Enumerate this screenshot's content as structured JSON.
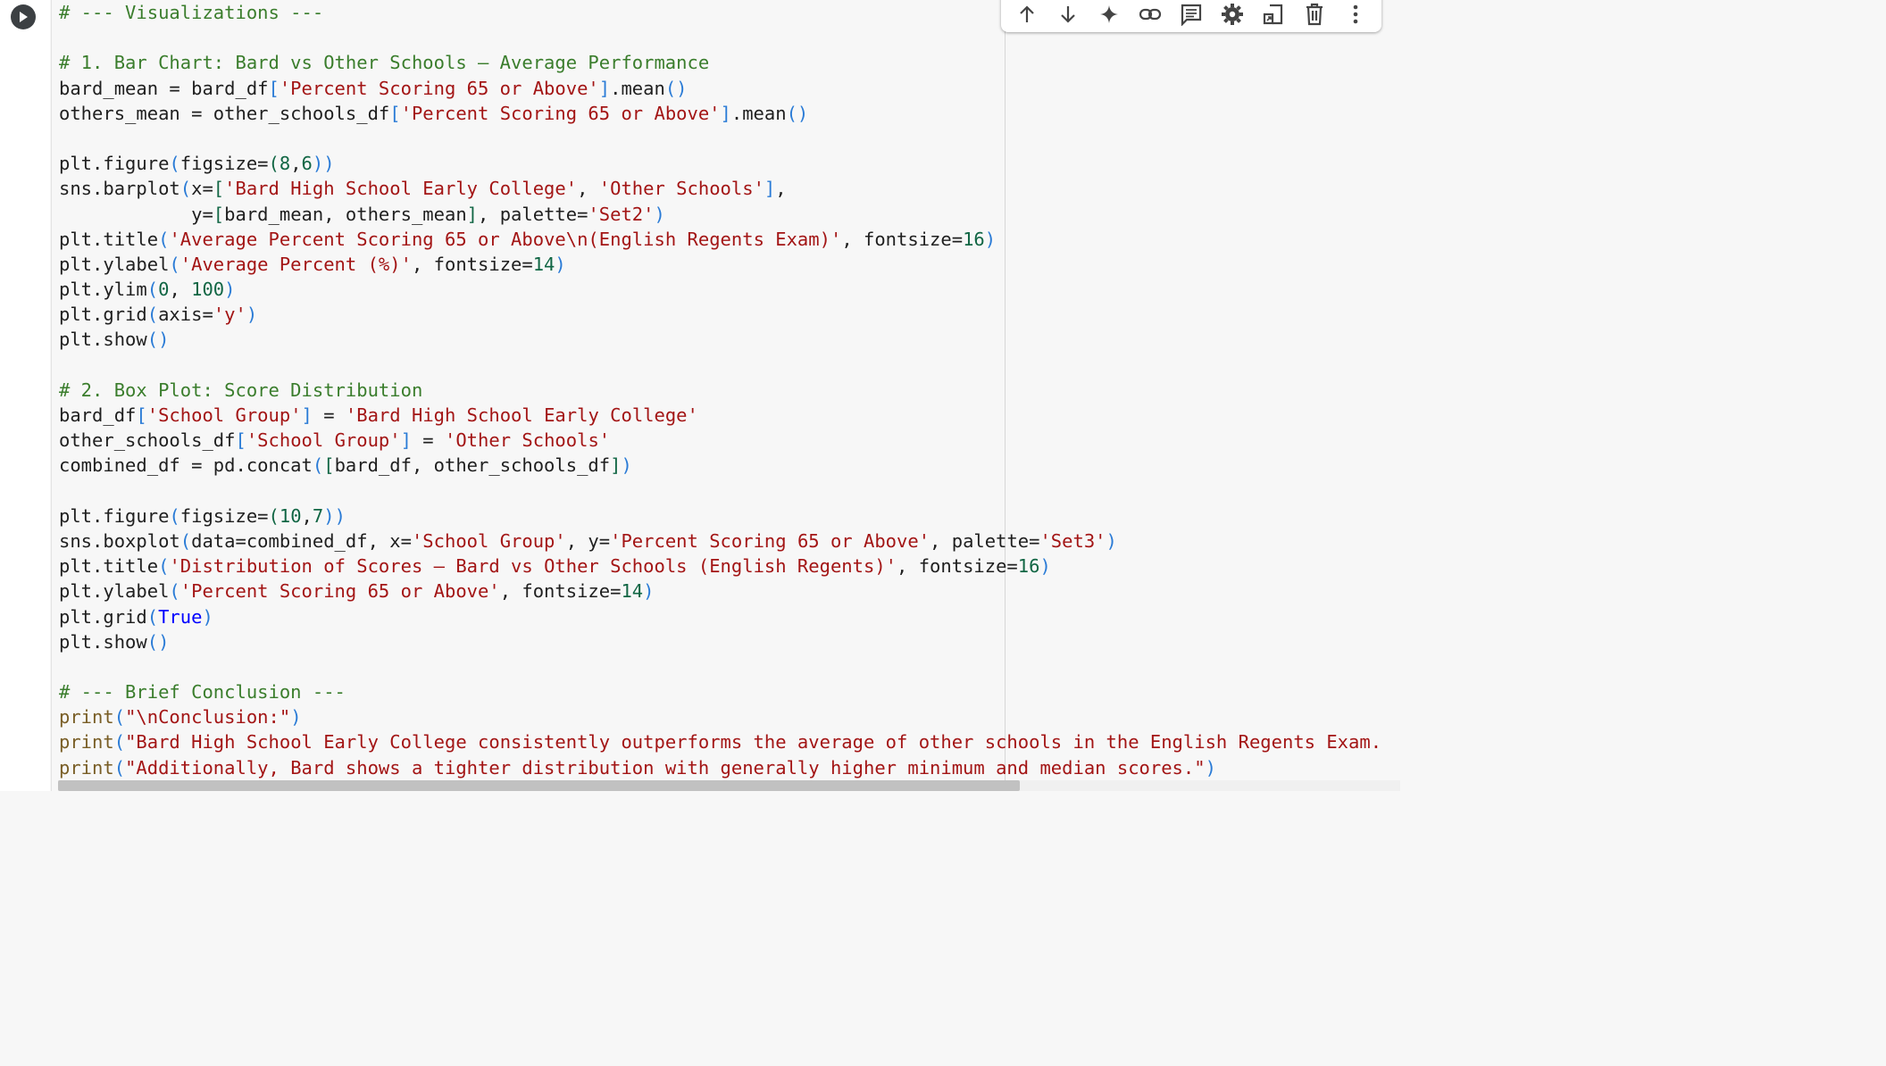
{
  "cell": {
    "run_icon": "play-icon",
    "lines": [
      [
        {
          "t": "# --- Visualizations ---",
          "c": "cm"
        }
      ],
      [],
      [
        {
          "t": "# 1. Bar Chart: Bard vs Other Schools – Average Performance",
          "c": "cm"
        }
      ],
      [
        {
          "t": "bard_mean = bard_df"
        },
        {
          "t": "[",
          "c": "br"
        },
        {
          "t": "'Percent Scoring 65 or Above'",
          "c": "st"
        },
        {
          "t": "]",
          "c": "br"
        },
        {
          "t": ".mean"
        },
        {
          "t": "()",
          "c": "br"
        }
      ],
      [
        {
          "t": "others_mean = other_schools_df"
        },
        {
          "t": "[",
          "c": "br"
        },
        {
          "t": "'Percent Scoring 65 or Above'",
          "c": "st"
        },
        {
          "t": "]",
          "c": "br"
        },
        {
          "t": ".mean"
        },
        {
          "t": "()",
          "c": "br"
        }
      ],
      [],
      [
        {
          "t": "plt.figure"
        },
        {
          "t": "(",
          "c": "br"
        },
        {
          "t": "figsize="
        },
        {
          "t": "(",
          "c": "nm"
        },
        {
          "t": "8",
          "c": "nm"
        },
        {
          "t": ","
        },
        {
          "t": "6",
          "c": "nm"
        },
        {
          "t": "))",
          "c": "br"
        }
      ],
      [
        {
          "t": "sns.barplot"
        },
        {
          "t": "(",
          "c": "br"
        },
        {
          "t": "x="
        },
        {
          "t": "[",
          "c": "nm"
        },
        {
          "t": "'Bard High School Early College'",
          "c": "st"
        },
        {
          "t": ", "
        },
        {
          "t": "'Other Schools'",
          "c": "st"
        },
        {
          "t": "]",
          "c": "br"
        },
        {
          "t": ","
        }
      ],
      [
        {
          "t": "            y="
        },
        {
          "t": "[",
          "c": "nm"
        },
        {
          "t": "bard_mean, others_mean"
        },
        {
          "t": "]",
          "c": "nm"
        },
        {
          "t": ", palette="
        },
        {
          "t": "'Set2'",
          "c": "st"
        },
        {
          "t": ")",
          "c": "br"
        }
      ],
      [
        {
          "t": "plt.title"
        },
        {
          "t": "(",
          "c": "br"
        },
        {
          "t": "'Average Percent Scoring 65 or Above\\n(English Regents Exam)'",
          "c": "st"
        },
        {
          "t": ", fontsize="
        },
        {
          "t": "16",
          "c": "nm"
        },
        {
          "t": ")",
          "c": "br"
        }
      ],
      [
        {
          "t": "plt.ylabel"
        },
        {
          "t": "(",
          "c": "br"
        },
        {
          "t": "'Average Percent (%)'",
          "c": "st"
        },
        {
          "t": ", fontsize="
        },
        {
          "t": "14",
          "c": "nm"
        },
        {
          "t": ")",
          "c": "br"
        }
      ],
      [
        {
          "t": "plt.ylim"
        },
        {
          "t": "(",
          "c": "br"
        },
        {
          "t": "0",
          "c": "nm"
        },
        {
          "t": ", "
        },
        {
          "t": "100",
          "c": "nm"
        },
        {
          "t": ")",
          "c": "br"
        }
      ],
      [
        {
          "t": "plt.grid"
        },
        {
          "t": "(",
          "c": "br"
        },
        {
          "t": "axis="
        },
        {
          "t": "'y'",
          "c": "st"
        },
        {
          "t": ")",
          "c": "br"
        }
      ],
      [
        {
          "t": "plt.show"
        },
        {
          "t": "()",
          "c": "br"
        }
      ],
      [],
      [
        {
          "t": "# 2. Box Plot: Score Distribution",
          "c": "cm"
        }
      ],
      [
        {
          "t": "bard_df"
        },
        {
          "t": "[",
          "c": "br"
        },
        {
          "t": "'School Group'",
          "c": "st"
        },
        {
          "t": "]",
          "c": "br"
        },
        {
          "t": " = "
        },
        {
          "t": "'Bard High School Early College'",
          "c": "st"
        }
      ],
      [
        {
          "t": "other_schools_df"
        },
        {
          "t": "[",
          "c": "br"
        },
        {
          "t": "'School Group'",
          "c": "st"
        },
        {
          "t": "]",
          "c": "br"
        },
        {
          "t": " = "
        },
        {
          "t": "'Other Schools'",
          "c": "st"
        }
      ],
      [
        {
          "t": "combined_df = pd.concat"
        },
        {
          "t": "(",
          "c": "br"
        },
        {
          "t": "[",
          "c": "nm"
        },
        {
          "t": "bard_df, other_schools_df"
        },
        {
          "t": "]",
          "c": "nm"
        },
        {
          "t": ")",
          "c": "br"
        }
      ],
      [],
      [
        {
          "t": "plt.figure"
        },
        {
          "t": "(",
          "c": "br"
        },
        {
          "t": "figsize="
        },
        {
          "t": "(",
          "c": "nm"
        },
        {
          "t": "10",
          "c": "nm"
        },
        {
          "t": ","
        },
        {
          "t": "7",
          "c": "nm"
        },
        {
          "t": "))",
          "c": "br"
        }
      ],
      [
        {
          "t": "sns.boxplot"
        },
        {
          "t": "(",
          "c": "br"
        },
        {
          "t": "data=combined_df, x="
        },
        {
          "t": "'School Group'",
          "c": "st"
        },
        {
          "t": ", y="
        },
        {
          "t": "'Percent Scoring 65 or Above'",
          "c": "st"
        },
        {
          "t": ", palette="
        },
        {
          "t": "'Set3'",
          "c": "st"
        },
        {
          "t": ")",
          "c": "br"
        }
      ],
      [
        {
          "t": "plt.title"
        },
        {
          "t": "(",
          "c": "br"
        },
        {
          "t": "'Distribution of Scores – Bard vs Other Schools (English Regents)'",
          "c": "st"
        },
        {
          "t": ", fontsize="
        },
        {
          "t": "16",
          "c": "nm"
        },
        {
          "t": ")",
          "c": "br"
        }
      ],
      [
        {
          "t": "plt.ylabel"
        },
        {
          "t": "(",
          "c": "br"
        },
        {
          "t": "'Percent Scoring 65 or Above'",
          "c": "st"
        },
        {
          "t": ", fontsize="
        },
        {
          "t": "14",
          "c": "nm"
        },
        {
          "t": ")",
          "c": "br"
        }
      ],
      [
        {
          "t": "plt.grid"
        },
        {
          "t": "(",
          "c": "br"
        },
        {
          "t": "True",
          "c": "kw"
        },
        {
          "t": ")",
          "c": "br"
        }
      ],
      [
        {
          "t": "plt.show"
        },
        {
          "t": "()",
          "c": "br"
        }
      ],
      [],
      [
        {
          "t": "# --- Brief Conclusion ---",
          "c": "cm"
        }
      ],
      [
        {
          "t": "print",
          "c": "fn"
        },
        {
          "t": "(",
          "c": "br"
        },
        {
          "t": "\"\\nConclusion:\"",
          "c": "st"
        },
        {
          "t": ")",
          "c": "br"
        }
      ],
      [
        {
          "t": "print",
          "c": "fn"
        },
        {
          "t": "(",
          "c": "br"
        },
        {
          "t": "\"Bard High School Early College consistently outperforms the average of other schools in the English Regents Exam.",
          "c": "st"
        }
      ],
      [
        {
          "t": "print",
          "c": "fn"
        },
        {
          "t": "(",
          "c": "br"
        },
        {
          "t": "\"Additionally, Bard shows a tighter distribution with generally higher minimum and median scores.\"",
          "c": "st"
        },
        {
          "t": ")",
          "c": "br"
        }
      ]
    ]
  },
  "toolbar": {
    "buttons": [
      {
        "name": "move-up-button",
        "icon": "arrow-up-icon"
      },
      {
        "name": "move-down-button",
        "icon": "arrow-down-icon"
      },
      {
        "name": "gemini-button",
        "icon": "sparkle-icon"
      },
      {
        "name": "link-button",
        "icon": "link-icon"
      },
      {
        "name": "comment-button",
        "icon": "comment-icon"
      },
      {
        "name": "settings-button",
        "icon": "gear-icon"
      },
      {
        "name": "mirror-cell-button",
        "icon": "mirror-cell-icon"
      },
      {
        "name": "delete-button",
        "icon": "trash-icon"
      },
      {
        "name": "more-button",
        "icon": "more-vert-icon"
      }
    ]
  },
  "colors": {
    "comment": "#3a7d2c",
    "string": "#a31515",
    "number": "#116644",
    "keyword": "#0000ff",
    "bracket": "#2a7bd6"
  }
}
